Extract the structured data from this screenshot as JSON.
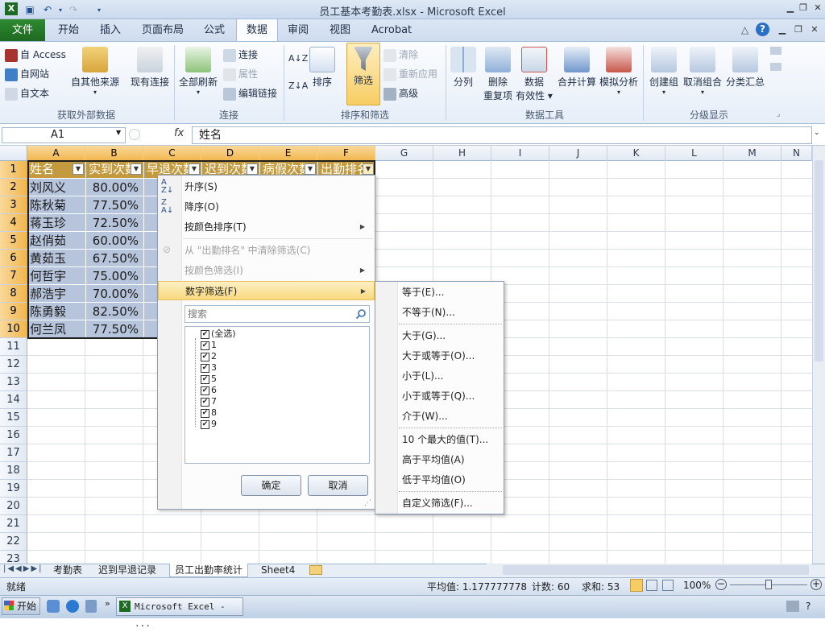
{
  "window": {
    "title": "员工基本考勤表.xlsx - Microsoft Excel"
  },
  "tabs": {
    "file": "文件",
    "items": [
      "开始",
      "插入",
      "页面布局",
      "公式",
      "数据",
      "审阅",
      "视图",
      "Acrobat"
    ],
    "active": "数据"
  },
  "ribbon": {
    "get_external": {
      "label": "获取外部数据",
      "access": "自 Access",
      "web": "自网站",
      "text": "自文本",
      "other": "自其他来源",
      "existing": "现有连接"
    },
    "connections": {
      "label": "连接",
      "refresh_all": "全部刷新",
      "connections": "连接",
      "properties": "属性",
      "edit_links": "编辑链接"
    },
    "sort_filter": {
      "label": "排序和筛选",
      "sort": "排序",
      "filter": "筛选",
      "clear": "清除",
      "reapply": "重新应用",
      "advanced": "高级"
    },
    "data_tools": {
      "label": "数据工具",
      "text_to_col": "分列",
      "remove_dup_1": "删除",
      "remove_dup_2": "重复项",
      "validation_1": "数据",
      "validation_2": "有效性",
      "consolidate": "合并计算",
      "what_if": "模拟分析"
    },
    "outline": {
      "label": "分级显示",
      "group": "创建组",
      "ungroup": "取消组合",
      "subtotal": "分类汇总"
    }
  },
  "formula_bar": {
    "name_box": "A1",
    "fx": "fx",
    "value": "姓名"
  },
  "columns": [
    "A",
    "B",
    "C",
    "D",
    "E",
    "F",
    "G",
    "H",
    "I",
    "J",
    "K",
    "L",
    "M",
    "N"
  ],
  "rows": [
    "1",
    "2",
    "3",
    "4",
    "5",
    "6",
    "7",
    "8",
    "9",
    "10",
    "11",
    "12",
    "13",
    "14",
    "15",
    "16",
    "17",
    "18",
    "19",
    "20",
    "21",
    "22",
    "23"
  ],
  "sheet": {
    "headers": [
      "姓名",
      "实到次数",
      "早退次数",
      "迟到次数",
      "病假次数",
      "出勤排名"
    ],
    "names": [
      "刘风义",
      "陈秋菊",
      "蒋玉珍",
      "赵俏茹",
      "黄茹玉",
      "何哲宇",
      "郝浩宇",
      "陈勇毅",
      "何兰凤"
    ],
    "rates": [
      "80.00%",
      "77.50%",
      "72.50%",
      "60.00%",
      "67.50%",
      "75.00%",
      "70.00%",
      "82.50%",
      "77.50%"
    ]
  },
  "filter_menu": {
    "sort_asc": "升序(S)",
    "sort_desc": "降序(O)",
    "sort_by_color": "按颜色排序(T)",
    "clear_filter": "从 \"出勤排名\" 中清除筛选(C)",
    "filter_by_color": "按颜色筛选(I)",
    "number_filters": "数字筛选(F)",
    "search_placeholder": "搜索",
    "items": [
      "(全选)",
      "1",
      "2",
      "3",
      "5",
      "6",
      "7",
      "8",
      "9"
    ],
    "ok": "确定",
    "cancel": "取消"
  },
  "number_filter_submenu": [
    "等于(E)...",
    "不等于(N)...",
    "大于(G)...",
    "大于或等于(O)...",
    "小于(L)...",
    "小于或等于(Q)...",
    "介于(W)...",
    "10 个最大的值(T)...",
    "高于平均值(A)",
    "低于平均值(O)",
    "自定义筛选(F)..."
  ],
  "sheet_tabs": [
    "考勤表",
    "迟到早退记录",
    "员工出勤率统计",
    "Sheet4"
  ],
  "status": {
    "ready": "就绪",
    "average": "平均值: 1.177777778",
    "count": "计数: 60",
    "sum": "求和: 53",
    "zoom": "100%"
  },
  "taskbar": {
    "start": "开始",
    "app": "Microsoft Excel - ..."
  },
  "colors": {
    "file_tab": "#1d6a22",
    "header_fill": "#c39a3e",
    "selection": "#b6c4dc",
    "menu_highlight": "#f9d97e"
  }
}
